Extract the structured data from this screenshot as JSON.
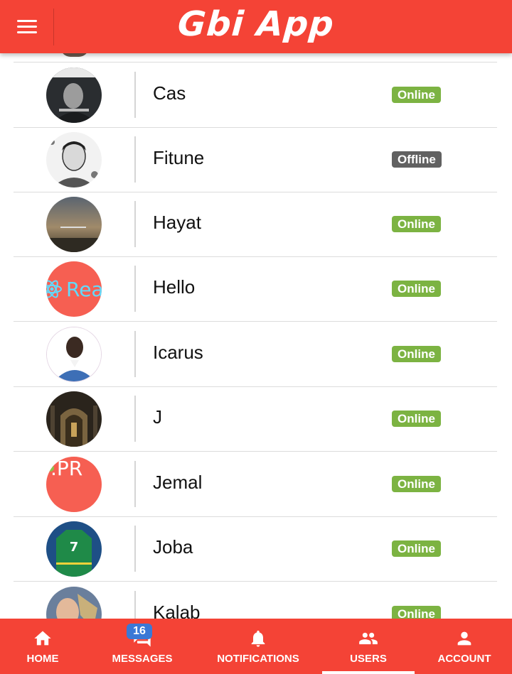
{
  "header": {
    "title": "Gbi App",
    "menu_icon": "menu-icon"
  },
  "users": [
    {
      "name": "Cas",
      "status": "Online",
      "avatar": "portrait-dark"
    },
    {
      "name": "Fitune",
      "status": "Offline",
      "avatar": "sketch-portrait"
    },
    {
      "name": "Hayat",
      "status": "Online",
      "avatar": "landscape-dusk"
    },
    {
      "name": "Hello",
      "status": "Online",
      "avatar": "react-logo-image"
    },
    {
      "name": "Icarus",
      "status": "Online",
      "avatar": "portrait-blue-shirt"
    },
    {
      "name": "J",
      "status": "Online",
      "avatar": "dark-throne-room"
    },
    {
      "name": "Jemal",
      "status": "Online",
      "avatar": "pr-text-image",
      "avatar_text": ".PR"
    },
    {
      "name": "Joba",
      "status": "Online",
      "avatar": "green-jersey",
      "avatar_text": "7"
    },
    {
      "name": "Kalab",
      "status": "Online",
      "avatar": "portrait-art"
    }
  ],
  "bottom_nav": {
    "items": [
      {
        "label": "HOME",
        "icon": "home-icon"
      },
      {
        "label": "MESSAGES",
        "icon": "chat-icon",
        "badge": "16"
      },
      {
        "label": "NOTIFICATIONS",
        "icon": "bell-icon"
      },
      {
        "label": "USERS",
        "icon": "people-icon",
        "active": true
      },
      {
        "label": "ACCOUNT",
        "icon": "person-icon"
      }
    ]
  },
  "colors": {
    "primary": "#f44336",
    "online": "#7cb342",
    "offline": "#616161",
    "badge": "#3a78d6"
  }
}
